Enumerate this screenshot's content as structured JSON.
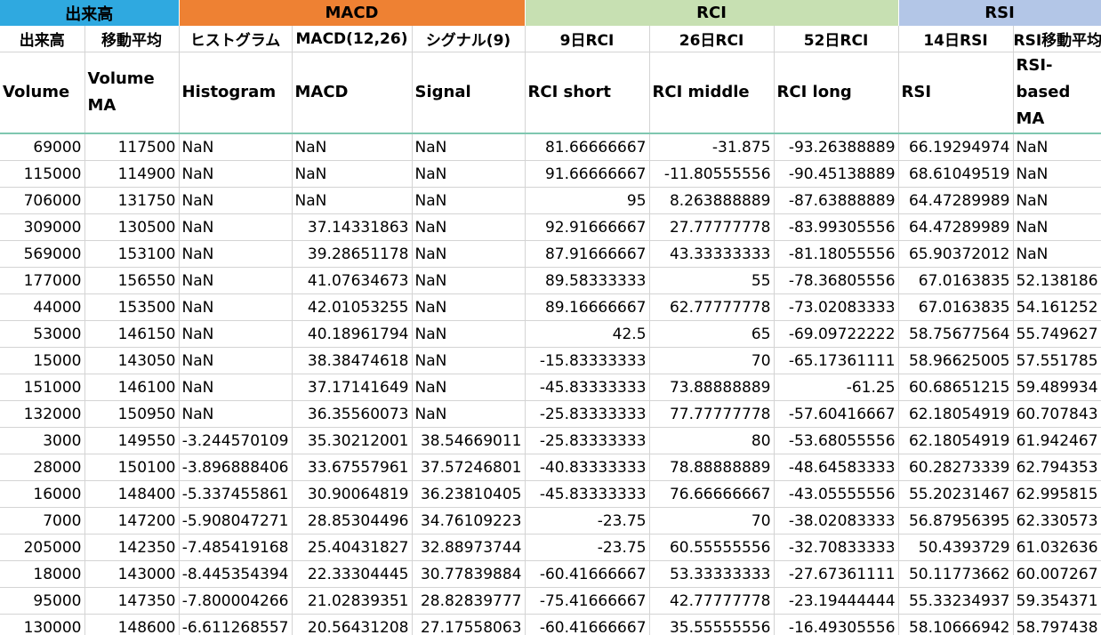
{
  "colors": {
    "volume_group": "#2fa9e0",
    "macd_group": "#ee8133",
    "rci_group": "#c7e0b2",
    "rsi_group": "#b3c6e7",
    "header_divider": "#7fc7b0",
    "gridline": "#d4d4d4"
  },
  "group_headers": [
    {
      "label": "出来高",
      "span": 2,
      "color": "#2fa9e0"
    },
    {
      "label": "MACD",
      "span": 3,
      "color": "#ee8133"
    },
    {
      "label": "RCI",
      "span": 3,
      "color": "#c7e0b2"
    },
    {
      "label": "RSI",
      "span": 2,
      "color": "#b3c6e7"
    }
  ],
  "sub_headers": [
    "出来高",
    "移動平均",
    "ヒストグラム",
    "MACD(12,26)",
    "シグナル(9)",
    "9日RCI",
    "26日RCI",
    "52日RCI",
    "14日RSI",
    "RSI移動平均"
  ],
  "column_names": [
    "Volume",
    "Volume MA",
    "Histogram",
    "MACD",
    "Signal",
    "RCI short",
    "RCI middle",
    "RCI long",
    "RSI",
    "RSI-based MA"
  ],
  "rows": [
    [
      "69000",
      "117500",
      "NaN",
      "NaN",
      "NaN",
      "81.66666667",
      "-31.875",
      "-93.26388889",
      "66.19294974",
      "NaN"
    ],
    [
      "115000",
      "114900",
      "NaN",
      "NaN",
      "NaN",
      "91.66666667",
      "-11.80555556",
      "-90.45138889",
      "68.61049519",
      "NaN"
    ],
    [
      "706000",
      "131750",
      "NaN",
      "NaN",
      "NaN",
      "95",
      "8.263888889",
      "-87.63888889",
      "64.47289989",
      "NaN"
    ],
    [
      "309000",
      "130500",
      "NaN",
      "37.14331863",
      "NaN",
      "92.91666667",
      "27.77777778",
      "-83.99305556",
      "64.47289989",
      "NaN"
    ],
    [
      "569000",
      "153100",
      "NaN",
      "39.28651178",
      "NaN",
      "87.91666667",
      "43.33333333",
      "-81.18055556",
      "65.90372012",
      "NaN"
    ],
    [
      "177000",
      "156550",
      "NaN",
      "41.07634673",
      "NaN",
      "89.58333333",
      "55",
      "-78.36805556",
      "67.0163835",
      "52.138186"
    ],
    [
      "44000",
      "153500",
      "NaN",
      "42.01053255",
      "NaN",
      "89.16666667",
      "62.77777778",
      "-73.02083333",
      "67.0163835",
      "54.161252"
    ],
    [
      "53000",
      "146150",
      "NaN",
      "40.18961794",
      "NaN",
      "42.5",
      "65",
      "-69.09722222",
      "58.75677564",
      "55.749627"
    ],
    [
      "15000",
      "143050",
      "NaN",
      "38.38474618",
      "NaN",
      "-15.83333333",
      "70",
      "-65.17361111",
      "58.96625005",
      "57.551785"
    ],
    [
      "151000",
      "146100",
      "NaN",
      "37.17141649",
      "NaN",
      "-45.83333333",
      "73.88888889",
      "-61.25",
      "60.68651215",
      "59.489934"
    ],
    [
      "132000",
      "150950",
      "NaN",
      "36.35560073",
      "NaN",
      "-25.83333333",
      "77.77777778",
      "-57.60416667",
      "62.18054919",
      "60.707843"
    ],
    [
      "3000",
      "149550",
      "-3.244570109",
      "35.30212001",
      "38.54669011",
      "-25.83333333",
      "80",
      "-53.68055556",
      "62.18054919",
      "61.942467"
    ],
    [
      "28000",
      "150100",
      "-3.896888406",
      "33.67557961",
      "37.57246801",
      "-40.83333333",
      "78.88888889",
      "-48.64583333",
      "60.28273339",
      "62.794353"
    ],
    [
      "16000",
      "148400",
      "-5.337455861",
      "30.90064819",
      "36.23810405",
      "-45.83333333",
      "76.66666667",
      "-43.05555556",
      "55.20231467",
      "62.995815"
    ],
    [
      "7000",
      "147200",
      "-5.908047271",
      "28.85304496",
      "34.76109223",
      "-23.75",
      "70",
      "-38.02083333",
      "56.87956395",
      "62.330573"
    ],
    [
      "205000",
      "142350",
      "-7.485419168",
      "25.40431827",
      "32.88973744",
      "-23.75",
      "60.55555556",
      "-32.70833333",
      "50.4393729",
      "61.032636"
    ],
    [
      "18000",
      "143000",
      "-8.445354394",
      "22.33304445",
      "30.77839884",
      "-60.41666667",
      "53.33333333",
      "-27.67361111",
      "50.11773662",
      "60.007267"
    ],
    [
      "95000",
      "147350",
      "-7.800004266",
      "21.02839351",
      "28.82839777",
      "-75.41666667",
      "42.77777778",
      "-23.19444444",
      "55.33234937",
      "59.354371"
    ],
    [
      "130000",
      "148600",
      "-6.611268557",
      "20.56431208",
      "27.17558063",
      "-60.41666667",
      "35.55555556",
      "-16.49305556",
      "58.10666942",
      "58.797438"
    ]
  ]
}
